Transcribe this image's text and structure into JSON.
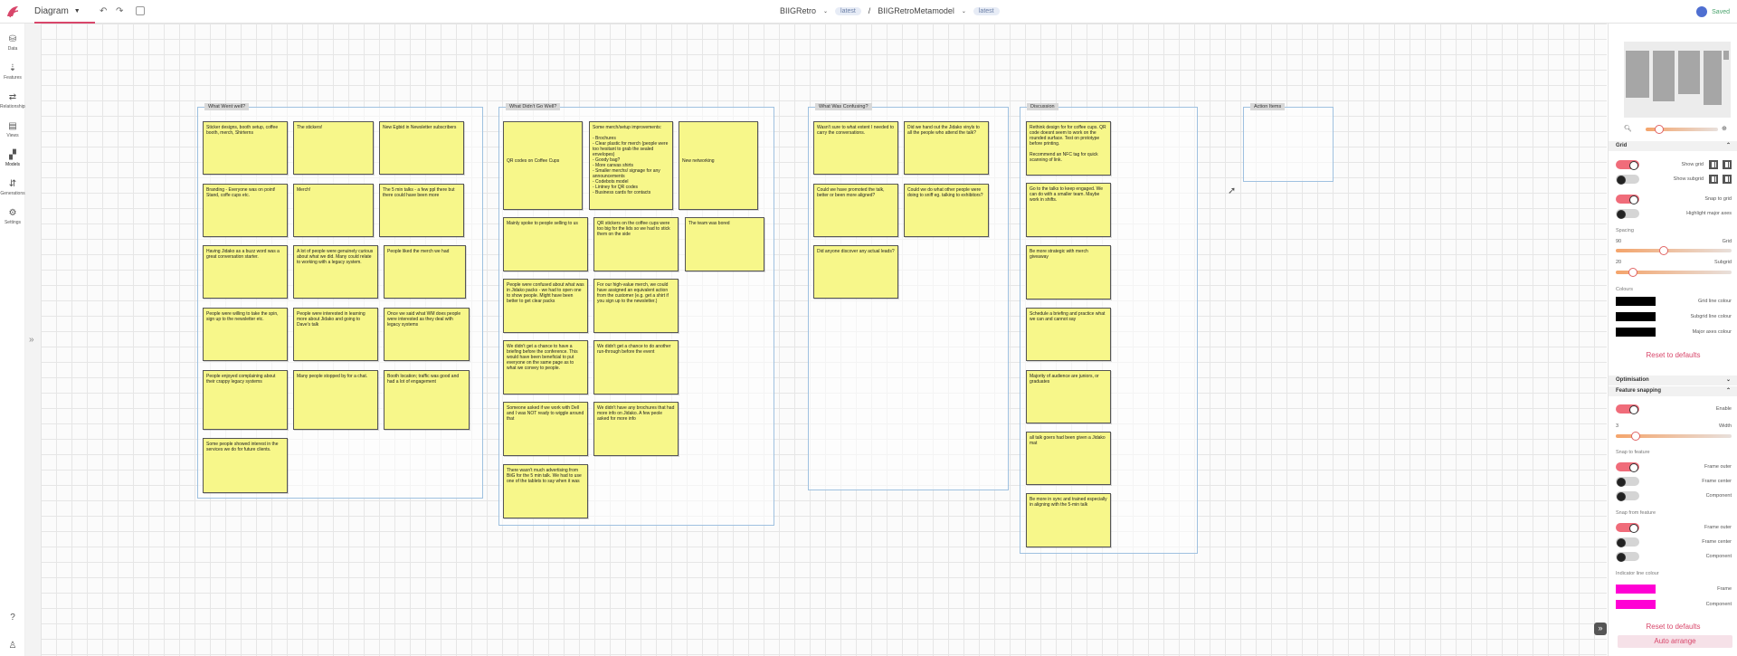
{
  "topbar": {
    "view_label": "Diagram",
    "project": "BIIGRetro",
    "project_badge": "latest",
    "separator": "/",
    "metamodel": "BIIGRetroMetamodel",
    "metamodel_badge": "latest",
    "status": "Saved"
  },
  "nav": [
    {
      "label": "Data",
      "icon": "database-icon"
    },
    {
      "label": "Features",
      "icon": "features-icon"
    },
    {
      "label": "Relationships",
      "icon": "relationships-icon"
    },
    {
      "label": "Views",
      "icon": "views-icon"
    },
    {
      "label": "Models",
      "icon": "models-icon"
    },
    {
      "label": "Generations",
      "icon": "generations-icon"
    },
    {
      "label": "Settings",
      "icon": "settings-icon"
    }
  ],
  "frames": {
    "well": "What Went well?",
    "didnt": "What Didn't Go Well?",
    "confusing": "What Was Confusing?",
    "discussion": "Discussion",
    "action": "Action Items"
  },
  "notes": {
    "w1": "Sticker designs, booth setup, coffee booth, merch, Shirterns",
    "w2": "The stickers!",
    "w3": "New Egbid in Newsletter subscribers",
    "w4": "Branding - Everyone was on point! Stand, coffe cups etc.",
    "w5": "Merch!",
    "w6": "The 5 min talks - a few ppl there but there could have been more",
    "w7": "Having Jidako as a buzz word was a great conversation starter.",
    "w8": "A lot of people were genuinely curious about what we did. Many could relate to working with a legacy system.",
    "w9": "People liked the merch we had",
    "w10": "People were willing to take the spin, sign up to the newsletter etc.",
    "w11": "People were interested in learning more about Jidako and going to Dave's talk",
    "w12": "Once we said what WM does people were interested as they deal with legacy systems",
    "w13": "People enjoyed complaining about their crappy legacy systems",
    "w14": "Many people stopped by for a chat.",
    "w15": "Booth location; traffic was good and had a lot of engagement",
    "w16": "Some people showed interest in the services we do for future clients.",
    "d1": "QR codes on Coffee Cups",
    "d2": "Some merch/setup improvements:\n\n- Brochures\n- Clear plastic for merch (people were too hesitant to grab the sealed envelopes)\n- Goody bag?\n- More canvas shirts\n- Smaller merchs/ signage for any announcements\n- Codebots model\n- Lintney for QR codes\n- Business cards for contacts",
    "d3": "New networking",
    "d4": "Mainly spoke to people selling to us",
    "d5": "QR stickers on the coffee cups were too big for the lids so we had to stick them on the side",
    "d6": "The team was bored",
    "d7": "People were confused about what was in Jidako packs - we had to open one to show people. Might have been better to get clear packs",
    "d8": "For our high-value merch, we could have assigned an equivalent action from the customer (e.g. get a shirt if you sign up to the newsletter.)",
    "d9": "We didn't get a chance to have a briefing before the conference. This would have been beneficial to put everyone on the same page as to what we convey to people.",
    "d10": "We didn't get a chance to do another run-through before the event",
    "d11": "Someone asked if we work with Dell and I was NOT ready to wiggle around that",
    "d12": "We didn't have any brochures that had more info on Jidako. A few peole asked for more info",
    "d13": "There wasn't much advertising from BiiG for the 5 min talk. We had to use one of the tablets to say when it was",
    "c1": "Wasn't sure to what extent I needed to carry the conversations.",
    "c2": "Did we hand out the Jidako vinyls to all the people who attend the talk?",
    "c3": "Could we have promoted the talk, better or been more aligned?",
    "c4": "Could we do what other people were doing to sniff eg. talking to exhibitors?",
    "c5": "Did anyone discover any actual leads?",
    "s1": "Rethink design for for coffee cups. QR code doesnt seem to work on the rounded surface. Test on prototype before printing.\n\nRecommend an NFC tag for quick scanning of link.",
    "s2": "Go to the talks to keep engaged. We can do with a smaller team. Maybe work in shifts.",
    "s3": "Be more strategic with merch giveaway",
    "s4": "Schedule a briefing and practice what we can and cannot say",
    "s5": "Majority of audience are juniors, or graduates",
    "s6": "all talk goers had been given a Jidako mat",
    "s7": "Be more in sync and trained especially in aligning with the 5-min talk"
  },
  "panel": {
    "grid_header": "Grid",
    "show_grid": "Show grid",
    "show_subgrid": "Show subgrid",
    "snap_to_grid": "Snap to grid",
    "highlight_axes": "Highlight major axes",
    "spacing": "Spacing",
    "grid_val": "90",
    "grid_label": "Grid",
    "subgrid_val": "20",
    "subgrid_label": "Subgrid",
    "colours": "Colours",
    "grid_line_colour": "Grid line colour",
    "subgrid_line_colour": "Subgrid line colour",
    "major_axes_colour": "Major axes colour",
    "reset": "Reset to defaults",
    "optimisation": "Optimisation",
    "feature_snapping": "Feature snapping",
    "enable": "Enable",
    "width_val": "3",
    "width_label": "Width",
    "snap_to_feature": "Snap to feature",
    "frame_outer": "Frame outer",
    "frame_center": "Frame center",
    "component": "Component",
    "snap_from_feature": "Snap from feature",
    "indicator_line_colour": "Indicator line colour",
    "frame": "Frame",
    "reset2": "Reset to defaults",
    "auto_arrange": "Auto arrange"
  },
  "colors": {
    "accent": "#d8466a",
    "note": "#f7f78a",
    "indicator": "#ff00d4",
    "swatch_black": "#000000"
  }
}
